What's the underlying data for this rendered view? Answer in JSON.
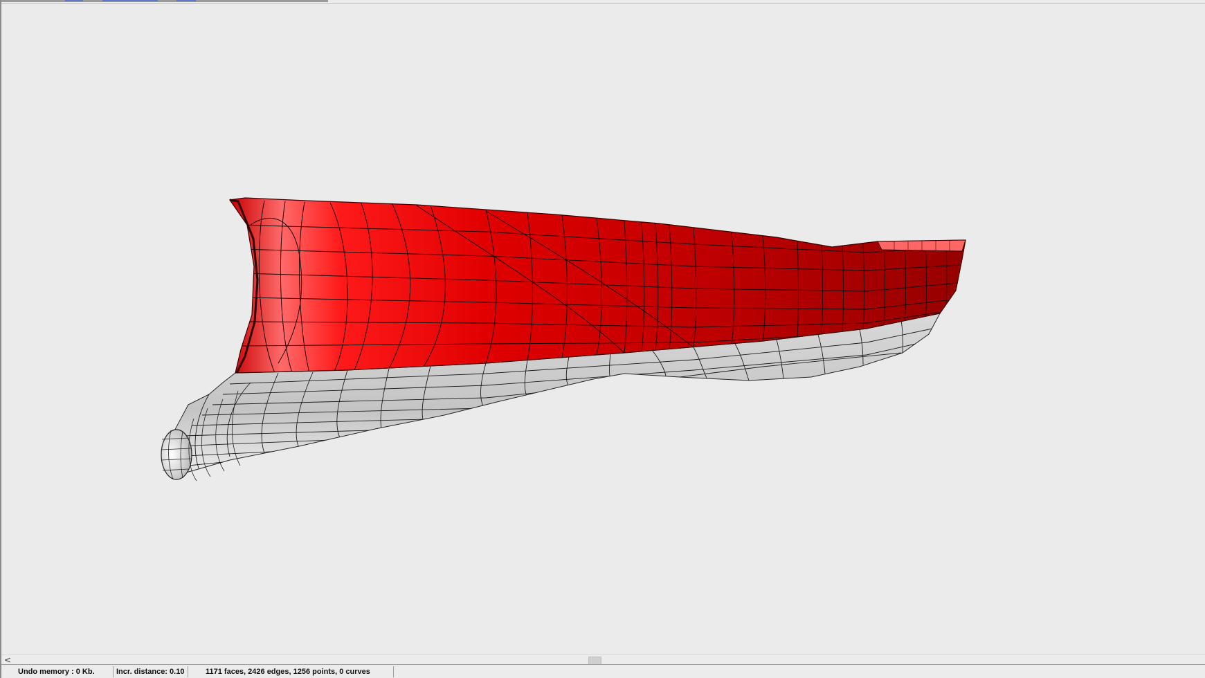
{
  "viewport": {
    "background": "#ebebeb",
    "model": "ship-hull",
    "shading": {
      "topsides": "#d40000",
      "underwater": "#c8c8c8",
      "wire": "#111111"
    }
  },
  "scrollbar": {
    "left_arrow": "<"
  },
  "status": {
    "undo_memory": "Undo memory : 0 Kb.",
    "incr_distance": "Incr. distance: 0.10",
    "geometry_stats": "1171 faces, 2426 edges, 1256 points, 0 curves"
  }
}
